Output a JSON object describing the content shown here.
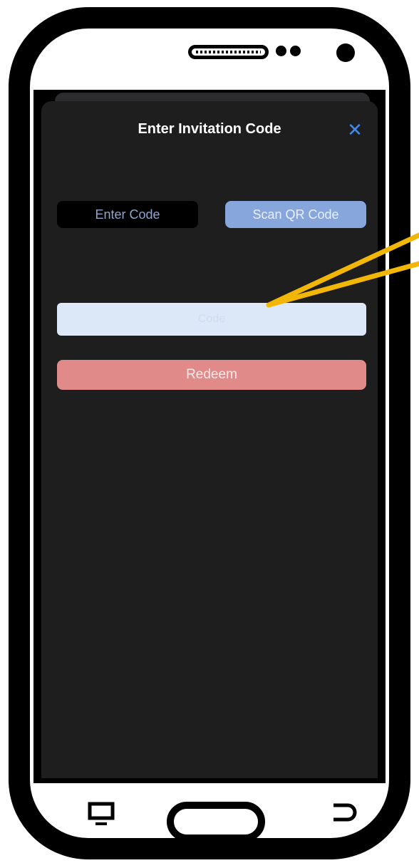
{
  "dialog": {
    "title": "Enter Invitation Code",
    "close_glyph": "✕"
  },
  "tabs": [
    {
      "label": "Enter Code",
      "selected": false
    },
    {
      "label": "Scan QR Code",
      "selected": true
    }
  ],
  "code_input": {
    "value": "",
    "placeholder": "Code"
  },
  "redeem_button": {
    "label": "Redeem"
  },
  "device_nav": {
    "recent_icon": "recent-apps-icon",
    "home_icon": "home-button",
    "back_icon": "back-icon"
  },
  "colors": {
    "accent": "#3b8cf2",
    "scan_tab": "#87a6dc",
    "redeem": "#e08a8a",
    "input_bg": "#dce8f8",
    "annotation_arrow": "#f2b705"
  }
}
